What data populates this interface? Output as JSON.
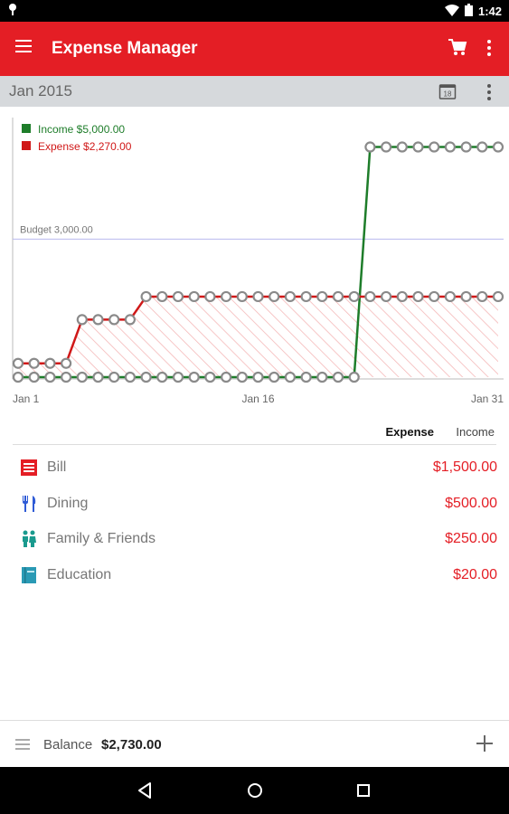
{
  "status_bar": {
    "time": "1:42"
  },
  "app_bar": {
    "title": "Expense Manager"
  },
  "sub_bar": {
    "month": "Jan 2015",
    "calendar_day": "18"
  },
  "chart_data": {
    "type": "line",
    "x_ticks": [
      "Jan 1",
      "Jan 16",
      "Jan 31"
    ],
    "legend": [
      {
        "label": "Income $5,000.00",
        "color": "#1e7d2a"
      },
      {
        "label": "Expense $2,270.00",
        "color": "#d01818"
      }
    ],
    "budget": {
      "label": "Budget 3,000.00",
      "value": 3000
    },
    "ylim": [
      0,
      5600
    ],
    "series": [
      {
        "name": "Income",
        "color": "#1e7d2a",
        "x": [
          1,
          2,
          3,
          4,
          5,
          6,
          7,
          8,
          9,
          10,
          11,
          12,
          13,
          14,
          15,
          16,
          17,
          18,
          19,
          20,
          21,
          22,
          23,
          24,
          25,
          26,
          27,
          28,
          29,
          30,
          31
        ],
        "values": [
          0,
          0,
          0,
          0,
          0,
          0,
          0,
          0,
          0,
          0,
          0,
          0,
          0,
          0,
          0,
          0,
          0,
          0,
          0,
          0,
          0,
          0,
          5000,
          5000,
          5000,
          5000,
          5000,
          5000,
          5000,
          5000,
          5000
        ]
      },
      {
        "name": "Expense",
        "color": "#d01818",
        "x": [
          1,
          2,
          3,
          4,
          5,
          6,
          7,
          8,
          9,
          10,
          11,
          12,
          13,
          14,
          15,
          16,
          17,
          18,
          19,
          20,
          21,
          22,
          23,
          24,
          25,
          26,
          27,
          28,
          29,
          30,
          31
        ],
        "values": [
          300,
          300,
          300,
          300,
          1250,
          1250,
          1250,
          1250,
          1750,
          1750,
          1750,
          1750,
          1750,
          1750,
          1750,
          1750,
          1750,
          1750,
          1750,
          1750,
          1750,
          1750,
          1750,
          1750,
          1750,
          1750,
          1750,
          1750,
          1750,
          1750,
          1750
        ]
      }
    ]
  },
  "tabs": {
    "expense": "Expense",
    "income": "Income"
  },
  "categories": [
    {
      "name": "Bill",
      "amount": "$1,500.00",
      "icon": "bill-icon",
      "color": "#e41e25"
    },
    {
      "name": "Dining",
      "amount": "$500.00",
      "icon": "dining-icon",
      "color": "#2f5bd6"
    },
    {
      "name": "Family & Friends",
      "amount": "$250.00",
      "icon": "family-icon",
      "color": "#1a9a8e"
    },
    {
      "name": "Education",
      "amount": "$20.00",
      "icon": "book-icon",
      "color": "#2a9ab5"
    }
  ],
  "bottom_bar": {
    "balance_label": "Balance",
    "balance_value": "$2,730.00"
  }
}
